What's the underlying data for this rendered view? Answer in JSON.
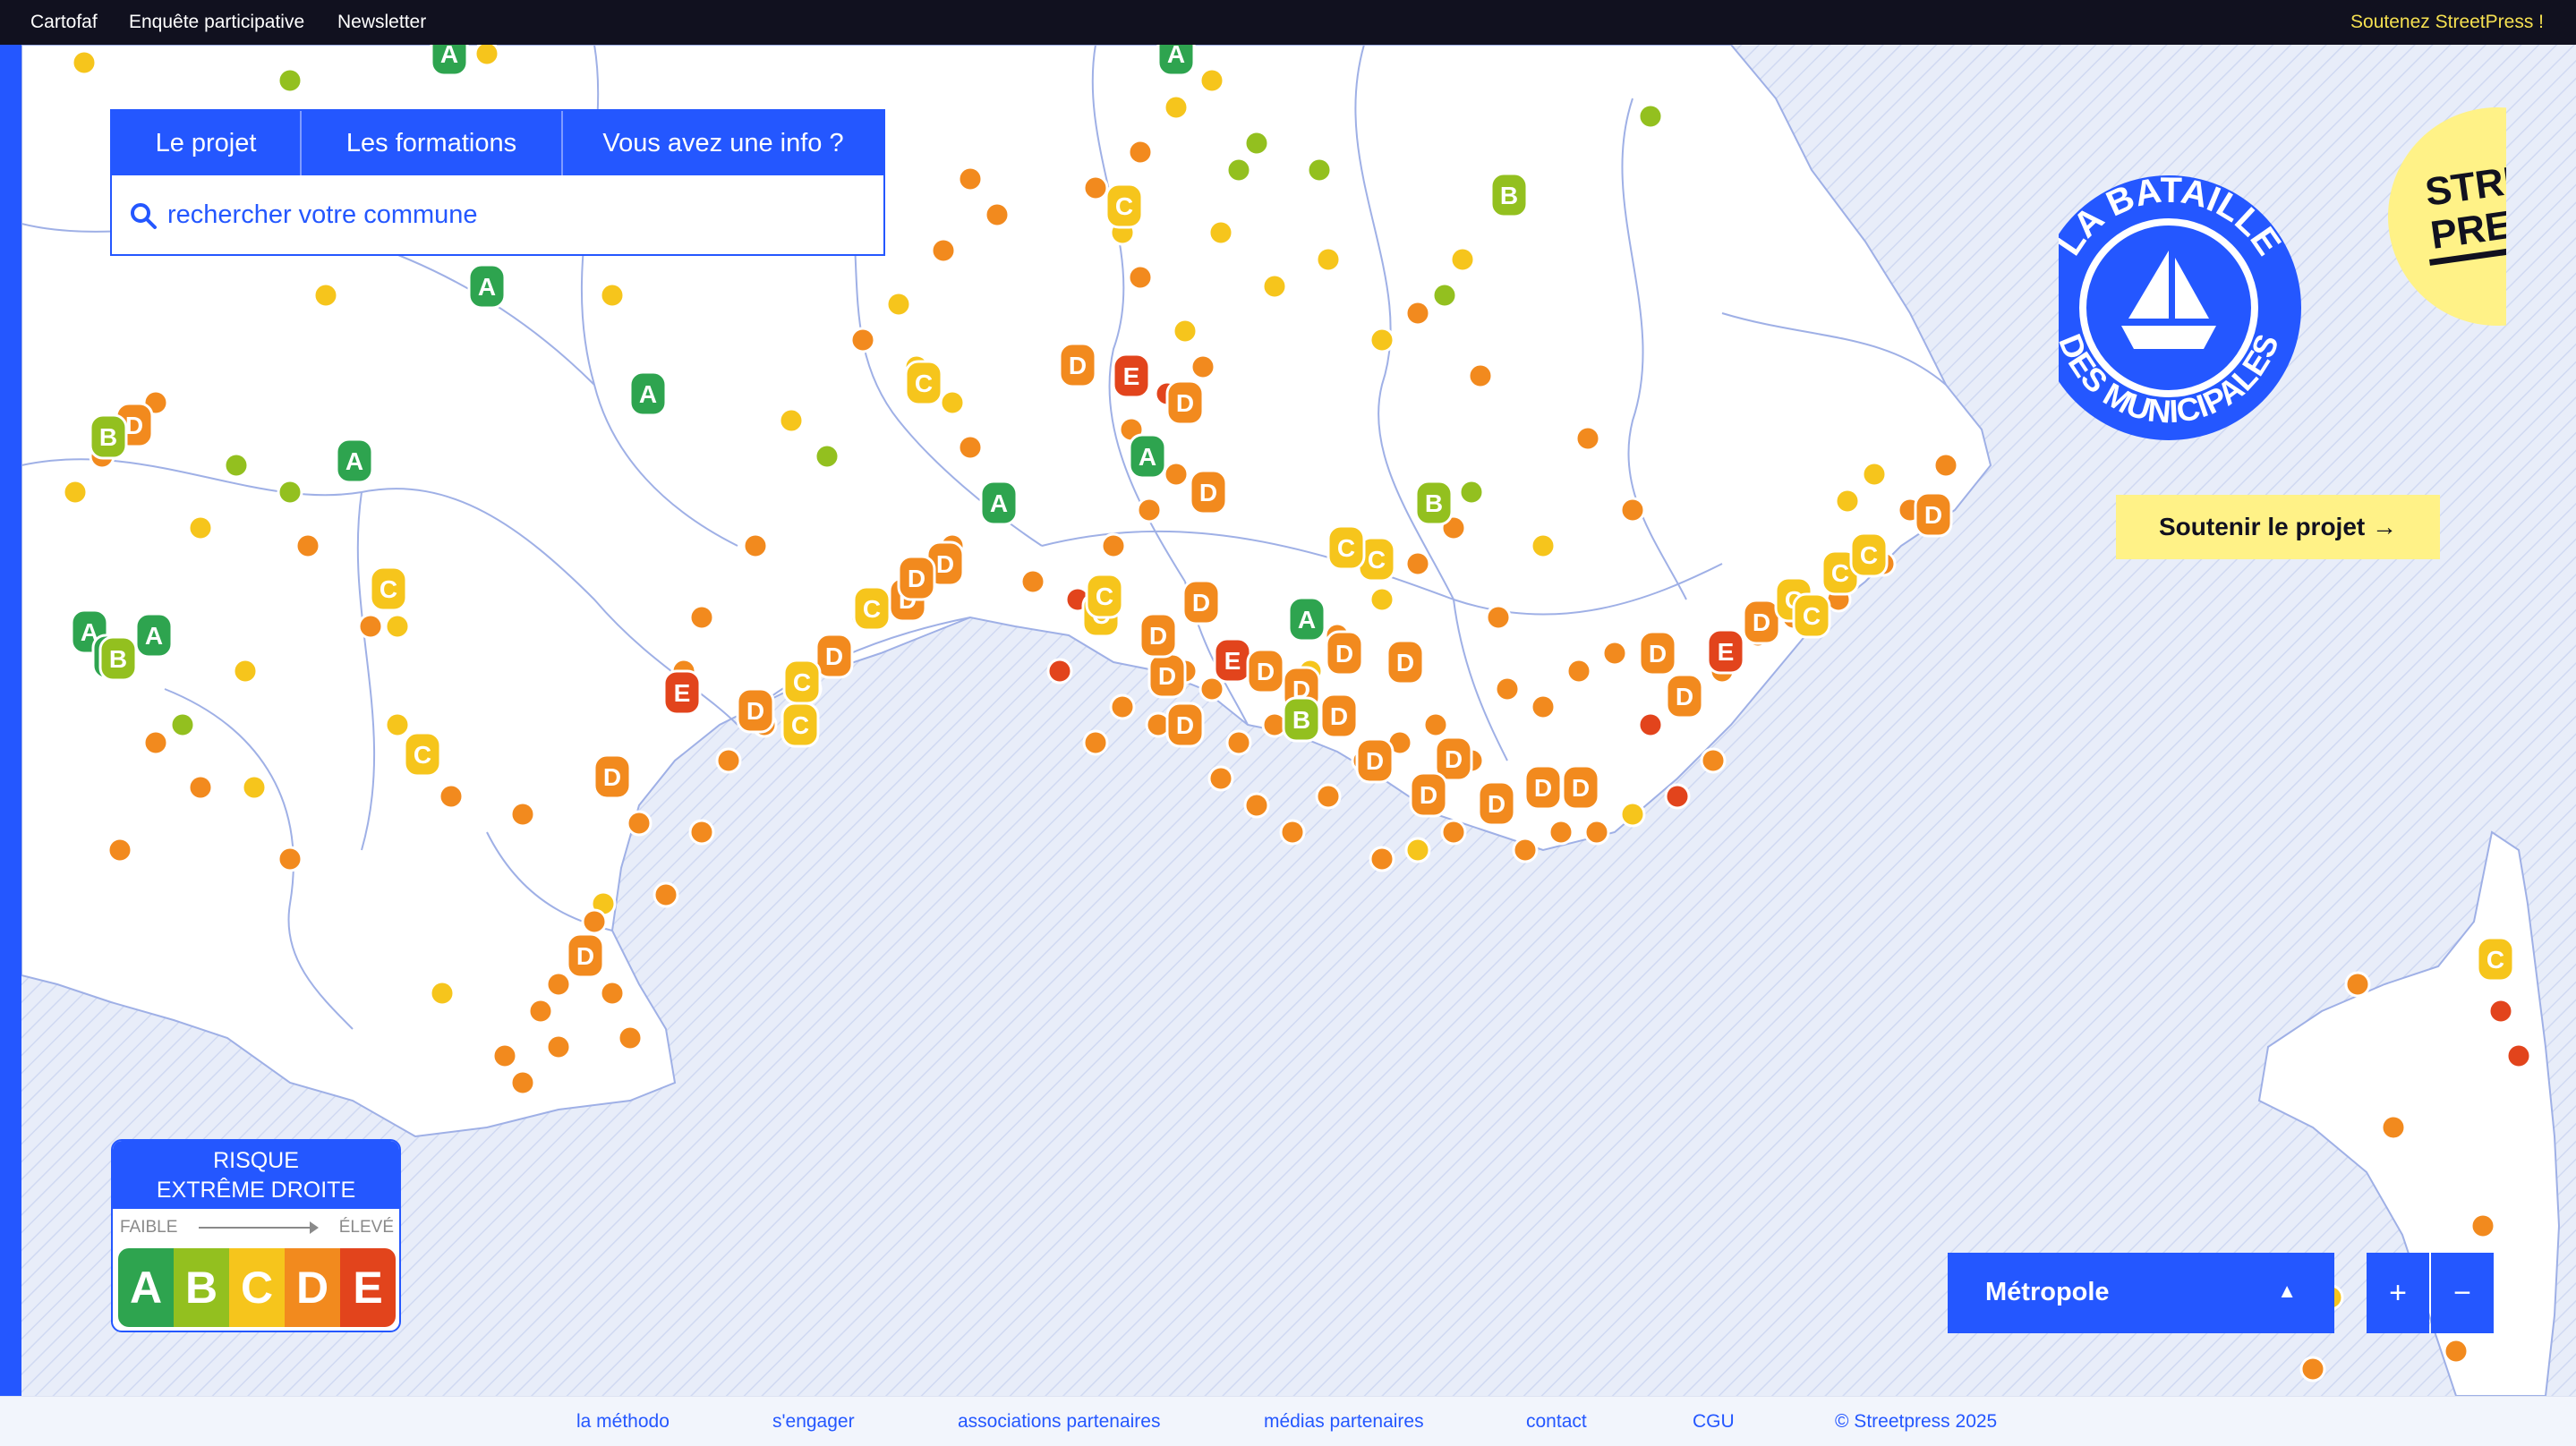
{
  "topbar": {
    "links": [
      "Cartofaf",
      "Enquête participative",
      "Newsletter"
    ],
    "support": "Soutenez StreetPress !"
  },
  "panel": {
    "tabs": [
      "Le projet",
      "Les formations",
      "Vous avez une info ?"
    ],
    "search_placeholder": "rechercher votre commune"
  },
  "legend": {
    "title_line1": "RISQUE",
    "title_line2": "EXTRÊME DROITE",
    "low": "FAIBLE",
    "high": "ÉLEVÉ",
    "grades": [
      {
        "letter": "A",
        "color": "#2ea44f"
      },
      {
        "letter": "B",
        "color": "#93c01f"
      },
      {
        "letter": "C",
        "color": "#f6c51c"
      },
      {
        "letter": "D",
        "color": "#f28a1e"
      },
      {
        "letter": "E",
        "color": "#e2441c"
      }
    ]
  },
  "logo": {
    "ring_top": "LA BATAILLE",
    "ring_bottom": "DES MUNICIPALES",
    "brand_line1": "STREET",
    "brand_line2": "PRESS"
  },
  "support_button": "Soutenir le projet →",
  "region_select": {
    "value": "Métropole",
    "caret": "▲"
  },
  "zoom": {
    "in": "+",
    "out": "−"
  },
  "footer": {
    "links": [
      "la méthodo",
      "s'engager",
      "associations partenaires",
      "médias partenaires",
      "contact",
      "CGU",
      "© Streetpress 2025"
    ]
  },
  "colors": {
    "accent": "#2457ff",
    "sea": "#e6ebf8",
    "land": "#ffffff",
    "border": "#9fb0e6",
    "A": "#2ea44f",
    "B": "#93c01f",
    "C": "#f6c51c",
    "D": "#f28a1e",
    "E": "#e2441c"
  },
  "map_markers": {
    "A": [],
    "B": [],
    "C": [],
    "D": [],
    "E": []
  }
}
